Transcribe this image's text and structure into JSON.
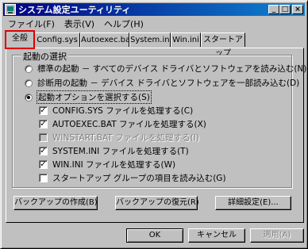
{
  "window": {
    "title": "システム設定ユーティリティ",
    "minimize": "_",
    "maximize": "□",
    "close": "×"
  },
  "menu": [
    "ファイル(F)",
    "表示(V)",
    "ヘルプ(H)"
  ],
  "tabs": [
    "全般",
    "Config.sys",
    "Autoexec.bat",
    "System.ini",
    "Win.ini",
    "スタートアップ"
  ],
  "active_tab": "全般",
  "startup_group": {
    "label": "起動の選択",
    "options": [
      {
        "label": "標準の起動 － すべてのデバイス ドライバとソフトウェアを読み込む(N)",
        "selected": false
      },
      {
        "label": "診断用の起動 － デバイス ドライバとソフトウェアを一部読み込む(D)",
        "selected": false
      },
      {
        "label": "起動オプションを選択する(S)",
        "selected": true
      }
    ],
    "checks": [
      {
        "label": "CONFIG.SYS ファイルを処理する(C)",
        "checked": true,
        "enabled": true
      },
      {
        "label": "AUTOEXEC.BAT ファイルを処理する(X)",
        "checked": true,
        "enabled": true
      },
      {
        "label": "WINSTART.BAT ファイルを処理する(I)",
        "checked": false,
        "enabled": false
      },
      {
        "label": "SYSTEM.INI ファイルを処理する(T)",
        "checked": true,
        "enabled": true
      },
      {
        "label": "WIN.INI ファイルを処理する(W)",
        "checked": true,
        "enabled": true
      },
      {
        "label": "スタートアップ グループの項目を読み込む(G)",
        "checked": false,
        "enabled": true
      }
    ]
  },
  "buttons": {
    "backup": "バックアップの作成(B)",
    "restore": "バックアップの復元(R)",
    "advanced": "詳細設定(E)...",
    "ok": "OK",
    "cancel": "キャンセル",
    "apply": "適用(A)"
  },
  "colors": {
    "titlebar_start": "#000080",
    "titlebar_end": "#1084d0",
    "highlight_outline": "#e00000"
  }
}
